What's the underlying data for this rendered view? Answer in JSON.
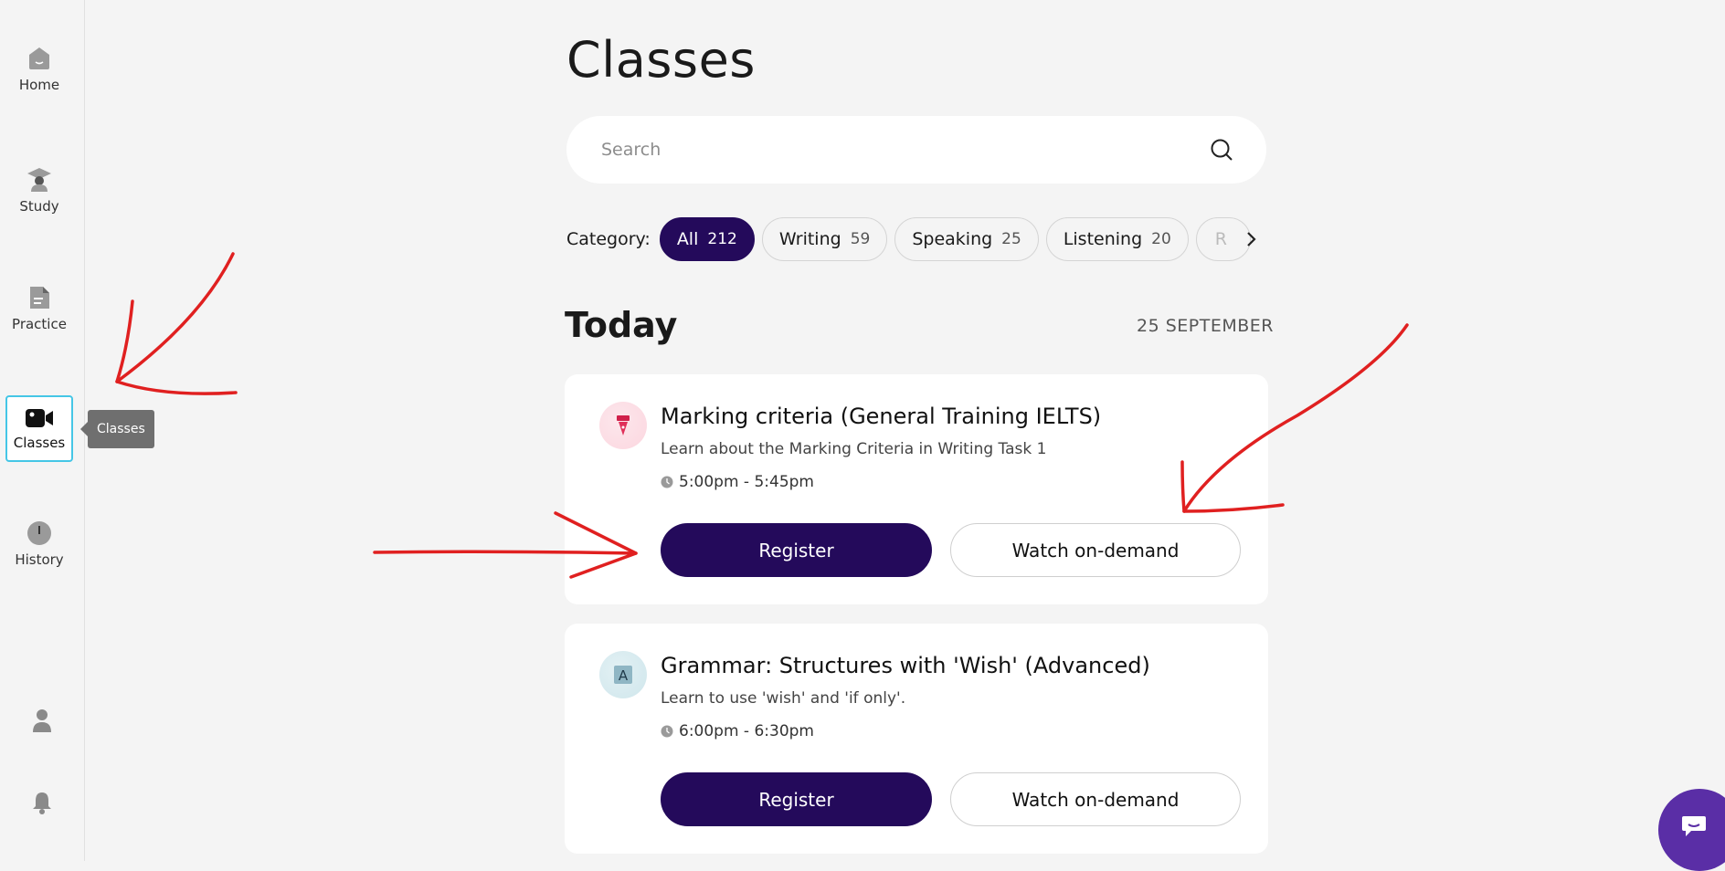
{
  "sidebar": {
    "items": [
      {
        "label": "Home",
        "icon": "home-icon"
      },
      {
        "label": "Study",
        "icon": "graduation-cap-icon"
      },
      {
        "label": "Practice",
        "icon": "document-icon"
      },
      {
        "label": "Classes",
        "icon": "video-camera-icon",
        "active": true
      },
      {
        "label": "History",
        "icon": "history-icon"
      }
    ],
    "tooltip": "Classes",
    "bottom_icons": [
      "profile-icon",
      "bell-icon"
    ]
  },
  "main": {
    "title": "Classes",
    "search": {
      "placeholder": "Search"
    },
    "category": {
      "label": "Category:",
      "chips": [
        {
          "label": "All",
          "count": "212",
          "active": true
        },
        {
          "label": "Writing",
          "count": "59"
        },
        {
          "label": "Speaking",
          "count": "25"
        },
        {
          "label": "Listening",
          "count": "20"
        },
        {
          "label": "R",
          "count": ""
        }
      ]
    },
    "section": {
      "title": "Today",
      "date": "25 SEPTEMBER"
    },
    "classes": [
      {
        "title": "Marking criteria (General Training IELTS)",
        "description": "Learn about the Marking Criteria in Writing Task 1",
        "time": "5:00pm - 5:45pm",
        "icon": "pen-nib-icon",
        "register_label": "Register",
        "watch_label": "Watch on-demand"
      },
      {
        "title": "Grammar: Structures with 'Wish' (Advanced)",
        "description": "Learn to use 'wish' and 'if only'.",
        "time": "6:00pm - 6:30pm",
        "icon": "letter-a-icon",
        "register_label": "Register",
        "watch_label": "Watch on-demand"
      }
    ]
  },
  "colors": {
    "primary": "#240a5b",
    "active_border": "#45c6e6",
    "chat": "#5a2ea6",
    "annotation": "#e02020"
  }
}
